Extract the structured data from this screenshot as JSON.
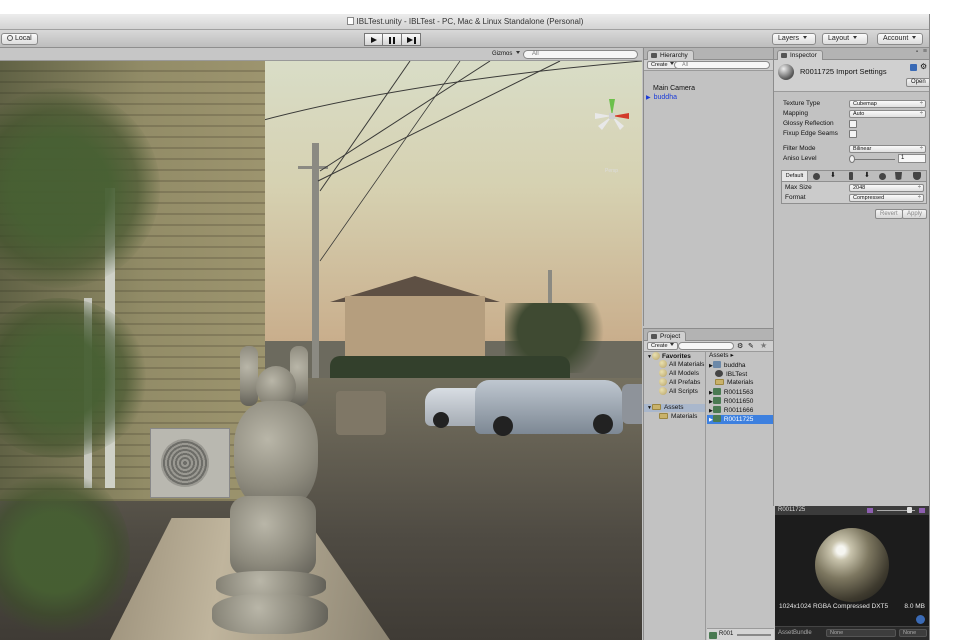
{
  "window": {
    "title": "IBLTest.unity - IBLTest - PC, Mac & Linux Standalone (Personal)"
  },
  "toolbar": {
    "local_label": "Local",
    "layers_label": "Layers",
    "layout_label": "Layout",
    "account_label": "Account"
  },
  "scene": {
    "gizmos_label": "Gizmos",
    "search_placeholder": "All",
    "persp_label": "Persp"
  },
  "hierarchy": {
    "tab": "Hierarchy",
    "create_label": "Create",
    "search_placeholder": "All",
    "items": [
      "Main Camera",
      "buddha"
    ]
  },
  "project": {
    "tab": "Project",
    "create_label": "Create",
    "favorites": {
      "label": "Favorites",
      "items": [
        "All Materials",
        "All Models",
        "All Prefabs",
        "All Scripts"
      ]
    },
    "assets_label": "Assets",
    "assets_children": [
      "Materials"
    ],
    "breadcrumb": "Assets",
    "files": [
      "buddha",
      "IBLTest",
      "Materials",
      "R0011563",
      "R0011650",
      "R0011666",
      "R0011725"
    ],
    "selected_file": "R0011725",
    "footer_label": "R001"
  },
  "inspector": {
    "tab": "Inspector",
    "header_title": "R0011725 Import Settings",
    "open_label": "Open",
    "texture_type_label": "Texture Type",
    "texture_type_value": "Cubemap",
    "mapping_label": "Mapping",
    "mapping_value": "Auto",
    "glossy_label": "Glossy Reflection",
    "fixup_label": "Fixup Edge Seams",
    "filter_label": "Filter Mode",
    "filter_value": "Bilinear",
    "aniso_label": "Aniso Level",
    "aniso_value": "1",
    "platform_default": "Default",
    "max_size_label": "Max Size",
    "max_size_value": "2048",
    "format_label": "Format",
    "format_value": "Compressed",
    "revert_label": "Revert",
    "apply_label": "Apply"
  },
  "preview": {
    "title": "R0011725",
    "info_text": "1024x1024  RGBA Compressed DXT5",
    "size_text": "8.0 MB",
    "assetbundle_label": "AssetBundle",
    "bundle_value": "None",
    "variant_value": "None"
  },
  "colors": {
    "selection": "#3d80df",
    "panel": "#c2c2c2",
    "link_blue": "#1a3bd8"
  }
}
